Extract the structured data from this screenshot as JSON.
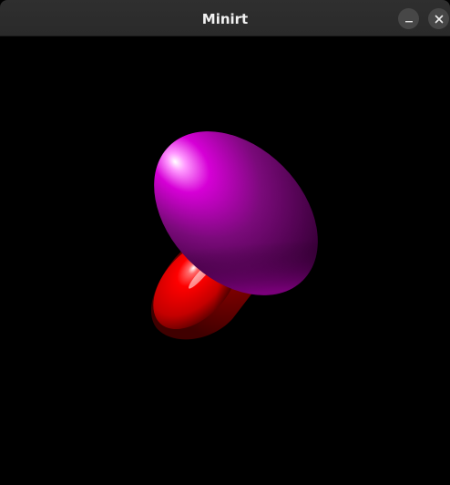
{
  "window": {
    "title": "Minirt",
    "controls": {
      "minimize_icon": "minimize-icon",
      "close_icon": "close-icon"
    }
  },
  "render": {
    "background_color": "#000000",
    "objects": [
      {
        "kind": "cylinder",
        "color": "#ff0000"
      },
      {
        "kind": "disc",
        "color": "#c000c0"
      }
    ]
  }
}
